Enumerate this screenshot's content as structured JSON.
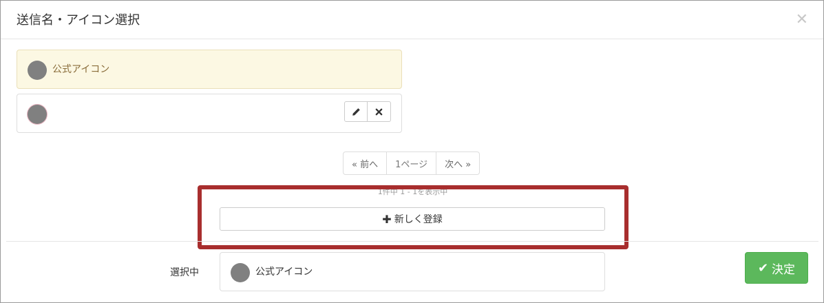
{
  "modal": {
    "title": "送信名・アイコン選択",
    "close_icon": "close-icon"
  },
  "icon_list": [
    {
      "label": "公式アイコン",
      "selected": true
    },
    {
      "label": "",
      "selected": false,
      "edit_icon": "pencil-icon",
      "delete_icon": "times-icon"
    }
  ],
  "pagination": {
    "prev": "« 前へ",
    "current": "1ページ",
    "next": "次へ »"
  },
  "count_text": "1件中 1 - 1を表示中",
  "new_button": {
    "icon": "plus-icon",
    "label": "新しく登録"
  },
  "footer": {
    "selected_label": "選択中",
    "selected_value": "公式アイコン",
    "decide_icon": "check-icon",
    "decide_label": "決定"
  },
  "colors": {
    "selected_bg": "#fcf8e3",
    "decide_green": "#5cb85c",
    "highlight_red": "#a82e2e"
  }
}
